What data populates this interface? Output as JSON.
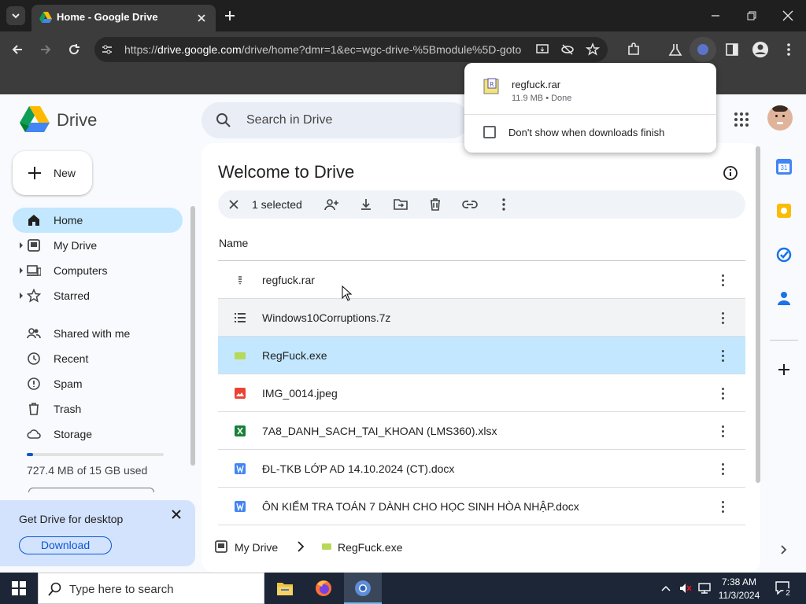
{
  "browser": {
    "tab_title": "Home - Google Drive",
    "url_prefix": "https://",
    "url_host": "drive.google.com",
    "url_path": "/drive/home?dmr=1&ec=wgc-drive-%5Bmodule%5D-goto"
  },
  "download_popup": {
    "file_name": "regfuck.rar",
    "file_status": "11.9 MB • Done",
    "checkbox_label": "Don't show when downloads finish"
  },
  "drive": {
    "logo_text": "Drive",
    "search_placeholder": "Search in Drive",
    "new_label": "New",
    "nav": [
      {
        "label": "Home",
        "icon": "home-icon",
        "active": true
      },
      {
        "label": "My Drive",
        "icon": "my-drive-icon",
        "caret": true
      },
      {
        "label": "Computers",
        "icon": "computers-icon",
        "caret": true
      },
      {
        "label": "Starred",
        "icon": "star-icon",
        "caret": true
      },
      {
        "label": "Shared with me",
        "icon": "shared-icon"
      },
      {
        "label": "Recent",
        "icon": "clock-icon"
      },
      {
        "label": "Spam",
        "icon": "spam-icon"
      },
      {
        "label": "Trash",
        "icon": "trash-icon"
      },
      {
        "label": "Storage",
        "icon": "cloud-icon"
      }
    ],
    "storage_text": "727.4 MB of 15 GB used",
    "storage_used_fraction": 0.047,
    "promo_title": "Get Drive for desktop",
    "promo_button": "Download",
    "welcome": "Welcome to Drive",
    "selected_text": "1 selected",
    "column_name": "Name",
    "files": [
      {
        "name": "regfuck.rar",
        "icon": "archive-icon",
        "state": "normal"
      },
      {
        "name": "Windows10Corruptions.7z",
        "icon": "list-icon",
        "state": "hover"
      },
      {
        "name": "RegFuck.exe",
        "icon": "exe-icon",
        "state": "selected"
      },
      {
        "name": "IMG_0014.jpeg",
        "icon": "image-icon",
        "state": "normal"
      },
      {
        "name": "7A8_DANH_SACH_TAI_KHOAN (LMS360).xlsx",
        "icon": "sheets-icon",
        "state": "normal"
      },
      {
        "name": "ĐL-TKB LỚP AD 14.10.2024 (CT).docx",
        "icon": "word-icon",
        "state": "normal"
      },
      {
        "name": "ÔN KIỂM TRA TOÁN 7 DÀNH CHO HỌC SINH HÒA NHẬP.docx",
        "icon": "word-icon",
        "state": "normal"
      }
    ],
    "breadcrumb": {
      "root": "My Drive",
      "current": "RegFuck.exe"
    }
  },
  "taskbar": {
    "search_placeholder": "Type here to search",
    "time": "7:38 AM",
    "date": "11/3/2024",
    "notification_count": "2"
  },
  "colors": {
    "selected_row": "#c2e7ff",
    "active_nav": "#c2e7ff",
    "accent_blue": "#0b57d0"
  }
}
